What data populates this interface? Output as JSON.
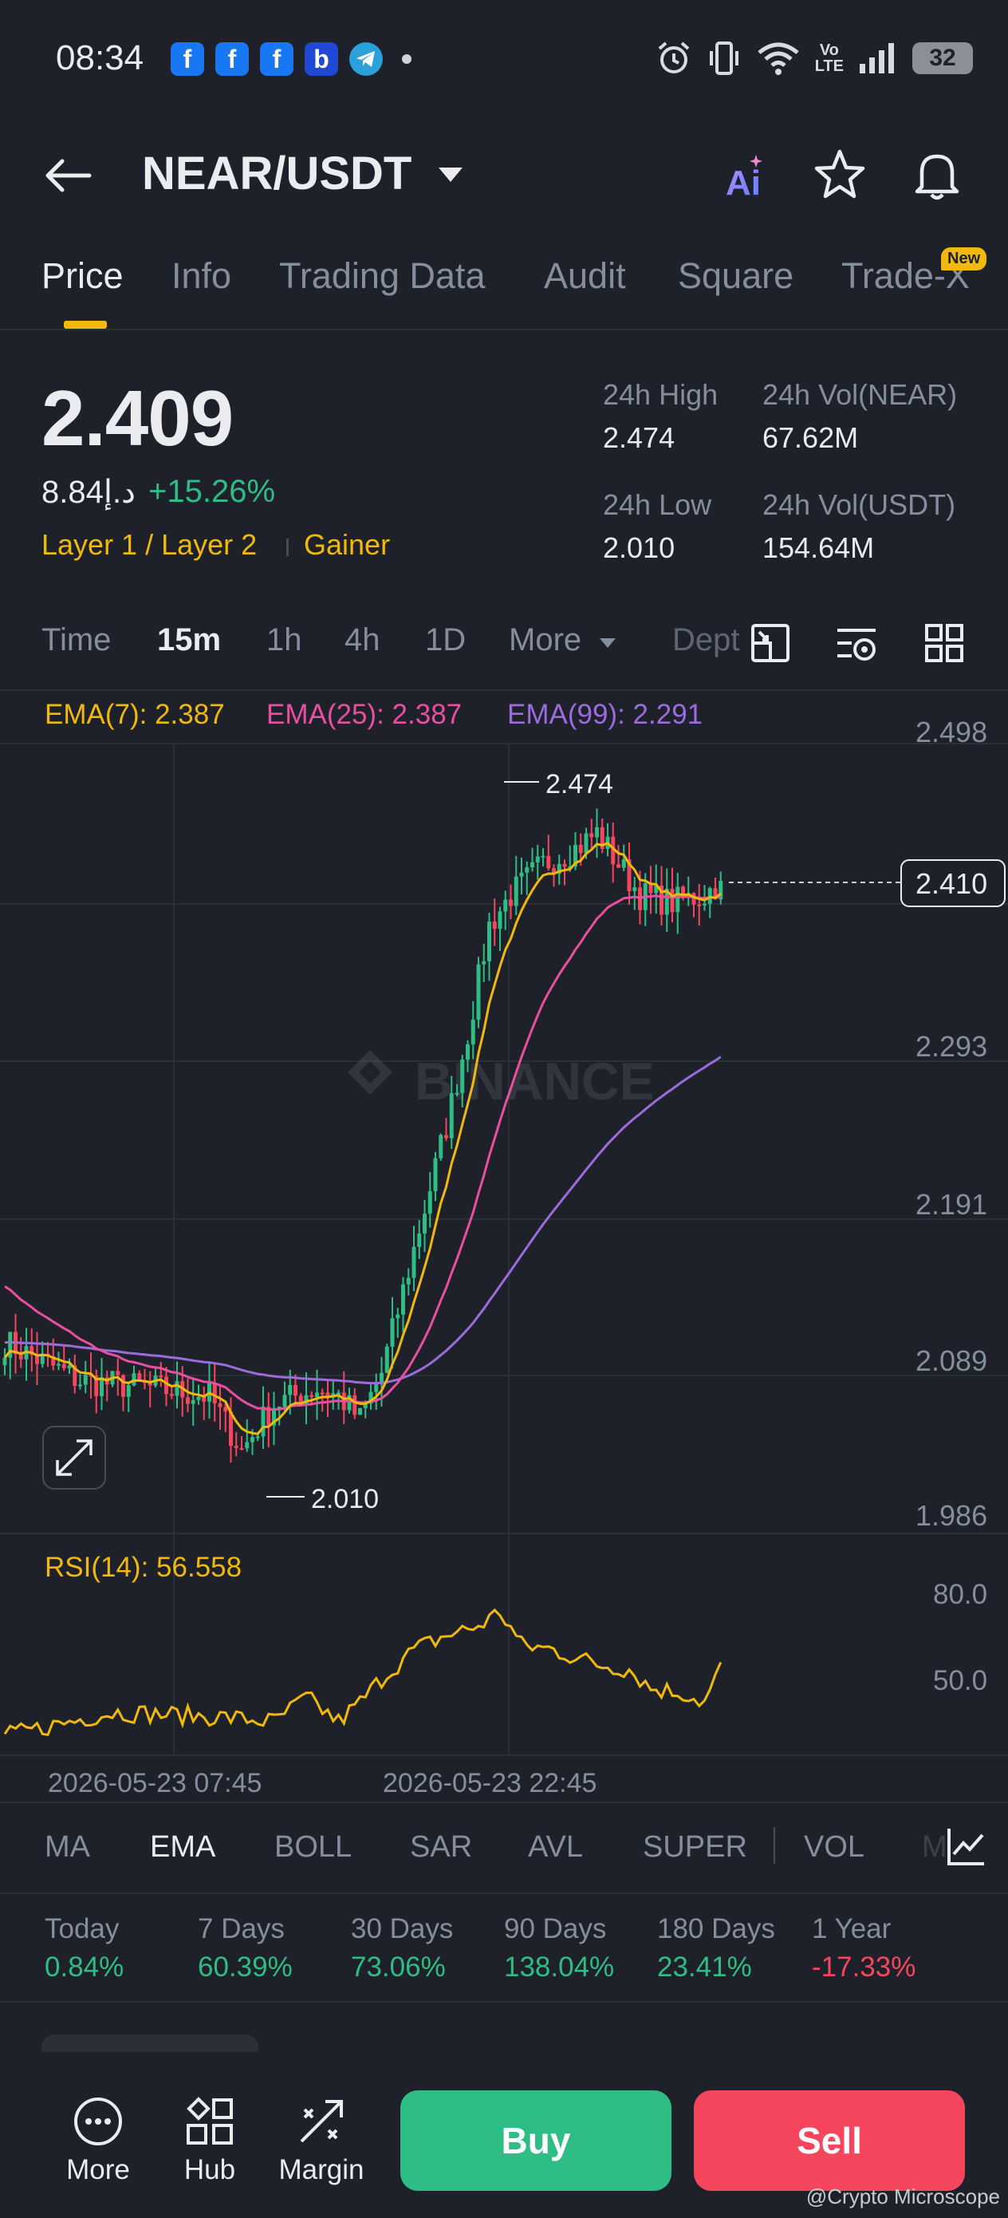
{
  "status_bar": {
    "time": "08:34",
    "battery": "32",
    "notifications": [
      "facebook-icon",
      "facebook-icon",
      "facebook-icon",
      "b-app-icon",
      "telegram-icon"
    ],
    "system_icons": [
      "alarm-icon",
      "vibrate-icon",
      "wifi-icon",
      "volte-icon",
      "signal-icon",
      "battery-icon"
    ],
    "volte_top": "Vo",
    "volte_bottom": "LTE"
  },
  "header": {
    "pair": "NEAR/USDT",
    "ai_label": "Ai"
  },
  "tabs": [
    "Price",
    "Info",
    "Trading Data",
    "Audit",
    "Square",
    "Trade-X"
  ],
  "tab_new_badge": "New",
  "price": {
    "last": "2.409",
    "fiat": "8.84د.إ",
    "change": "+15.26%",
    "tags": [
      "Layer 1 / Layer 2",
      "Gainer"
    ]
  },
  "stats": {
    "high_label": "24h High",
    "high_value": "2.474",
    "vol_base_label": "24h Vol(NEAR)",
    "vol_base_value": "67.62M",
    "low_label": "24h Low",
    "low_value": "2.010",
    "vol_quote_label": "24h Vol(USDT)",
    "vol_quote_value": "154.64M"
  },
  "intervals": [
    "Time",
    "15m",
    "1h",
    "4h",
    "1D",
    "More",
    "Dept"
  ],
  "chart": {
    "ema7": "EMA(7): 2.387",
    "ema25": "EMA(25): 2.387",
    "ema99": "EMA(99): 2.291",
    "price_ticks": [
      "2.498",
      "2.410",
      "2.293",
      "2.191",
      "2.089",
      "1.986"
    ],
    "high_marker": "2.474",
    "low_marker": "2.010",
    "rsi_label": "RSI(14): 56.558",
    "rsi_ticks": [
      "80.0",
      "50.0"
    ],
    "time_labels": [
      "2026-05-23 07:45",
      "2026-05-23 22:45"
    ],
    "watermark": "BINANCE",
    "colors": {
      "ema7": "#f0b90b",
      "ema25": "#e84fa0",
      "ema99": "#9b6cdc",
      "rsi": "#f0b90b",
      "up": "#2ebd85",
      "down": "#f6465d"
    }
  },
  "indicator_tabs": [
    "MA",
    "EMA",
    "BOLL",
    "SAR",
    "AVL",
    "SUPER",
    "VOL",
    "M"
  ],
  "performance": [
    {
      "label": "Today",
      "value": "0.84%",
      "color": "#2ebd85"
    },
    {
      "label": "7 Days",
      "value": "60.39%",
      "color": "#2ebd85"
    },
    {
      "label": "30 Days",
      "value": "73.06%",
      "color": "#2ebd85"
    },
    {
      "label": "90 Days",
      "value": "138.04%",
      "color": "#2ebd85"
    },
    {
      "label": "180 Days",
      "value": "23.41%",
      "color": "#2ebd85"
    },
    {
      "label": "1 Year",
      "value": "-17.33%",
      "color": "#f6465d"
    }
  ],
  "bottom_nav": {
    "more": "More",
    "hub": "Hub",
    "margin": "Margin",
    "buy": "Buy",
    "sell": "Sell"
  },
  "credit": "@Crypto Microscope"
}
